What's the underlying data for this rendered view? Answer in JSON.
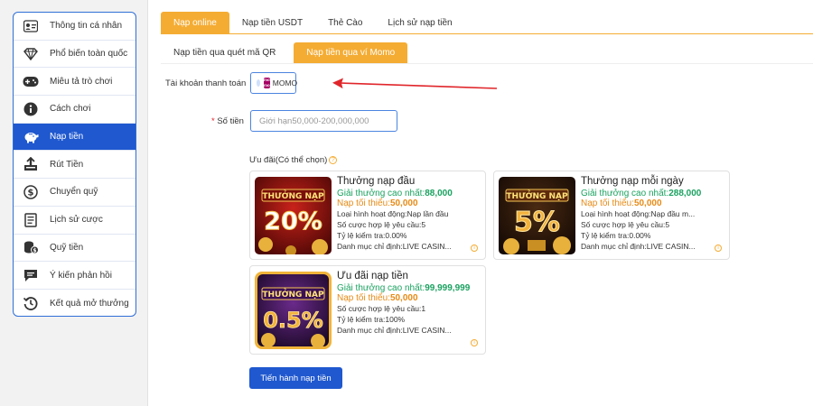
{
  "sidebar": {
    "items": [
      {
        "label": "Thông tin cá nhân",
        "icon": "user-card-icon"
      },
      {
        "label": "Phổ biến toàn quốc",
        "icon": "diamond-icon"
      },
      {
        "label": "Miêu tả trò chơi",
        "icon": "gamepad-icon"
      },
      {
        "label": "Cách chơi",
        "icon": "info-icon"
      },
      {
        "label": "Nạp tiền",
        "icon": "piggy-bank-icon"
      },
      {
        "label": "Rút Tiền",
        "icon": "withdraw-icon"
      },
      {
        "label": "Chuyển quỹ",
        "icon": "dollar-circle-icon"
      },
      {
        "label": "Lịch sử cược",
        "icon": "list-icon"
      },
      {
        "label": "Quỹ tiền",
        "icon": "coins-icon"
      },
      {
        "label": "Ý kiến phản hồi",
        "icon": "chat-icon"
      },
      {
        "label": "Kết quả mở thưởng",
        "icon": "history-icon"
      }
    ],
    "active_index": 4
  },
  "tabs": [
    "Nạp online",
    "Nạp tiền USDT",
    "Thẻ Cào",
    "Lịch sử nạp tiền"
  ],
  "subtabs": [
    "Nạp tiền qua quét mã QR",
    "Nạp tiền qua ví Momo"
  ],
  "form": {
    "account_label": "Tài khoản thanh toán",
    "momo_logo": "mo mo",
    "momo_label": "MOMO",
    "amount_required": "*",
    "amount_label": "Số tiền",
    "amount_placeholder": "Giới hạn50,000-200,000,000",
    "promo_label": "Ưu đãi(Có thể chọn)",
    "submit_label": "Tiến hành nạp tiền"
  },
  "promos": [
    {
      "badge_top": "THƯỞNG NẠP",
      "badge_value": "20%",
      "title": "Thưởng nạp đầu",
      "max_label": "Giải thưởng cao nhất:",
      "max_value": "88,000",
      "min_label": "Nạp tối thiểu:",
      "min_value": "50,000",
      "lines": [
        "Loại hình hoạt động:Nạp lần đầu",
        "Số cược hợp lệ yêu cầu:5",
        "Tỷ lệ kiểm tra:0.00%",
        "Danh mục chỉ định:LIVE CASIN..."
      ]
    },
    {
      "badge_top": "THƯỞNG NẠP",
      "badge_value": "5%",
      "title": "Thưởng nạp mỗi ngày",
      "max_label": "Giải thưởng cao nhất:",
      "max_value": "288,000",
      "min_label": "Nạp tối thiểu:",
      "min_value": "50,000",
      "lines": [
        "Loại hình hoạt động:Nạp đầu m...",
        "Số cược hợp lệ yêu cầu:5",
        "Tỷ lệ kiểm tra:0.00%",
        "Danh mục chỉ định:LIVE CASIN..."
      ]
    },
    {
      "badge_top": "THƯỞNG NẠP",
      "badge_value": "0.5%",
      "title": "Ưu đãi nạp tiền",
      "max_label": "Giải thưởng cao nhất:",
      "max_value": "99,999,999",
      "min_label": "Nạp tối thiểu:",
      "min_value": "50,000",
      "lines": [
        "Số cược hợp lệ yêu cầu:1",
        "Tỷ lệ kiểm tra:100%",
        "Danh mục chỉ định:LIVE CASIN..."
      ]
    }
  ],
  "colors": {
    "accent": "#f5ac33",
    "primary": "#1f58cf",
    "green": "#1aa260",
    "orange": "#e78b16",
    "annotation_arrow": "#e0262b"
  }
}
